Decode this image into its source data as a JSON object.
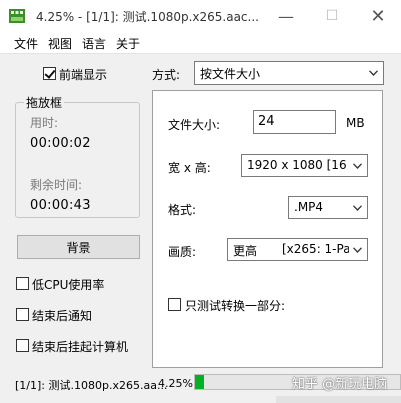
{
  "window": {
    "title": "4.25% - [1/1]: 测试.1080p.x265.aac...",
    "min_symbol": "—",
    "max_symbol": "☐",
    "close_symbol": "✕"
  },
  "menu": [
    "文件",
    "视图",
    "语言",
    "关于"
  ],
  "left": {
    "preview_label": "前端显示",
    "preview_checked": true,
    "drag_box_title": "拖放框",
    "elapsed_label": "用时:",
    "elapsed_value": "00:00:02",
    "remaining_label": "剩余时间:",
    "remaining_value": "00:00:43",
    "background_button": "背景",
    "options": [
      "低CPU使用率",
      "结束后通知",
      "结束后挂起计算机"
    ]
  },
  "right": {
    "method_label": "方式:",
    "method_value": "按文件大小",
    "filesize_label": "文件大小:",
    "filesize_value": "24",
    "filesize_unit": "MB",
    "resolution_label": "宽 x 高:",
    "resolution_value": "1920 x 1080  [16",
    "format_label": "格式:",
    "format_value": ".MP4",
    "quality_label": "画质:",
    "quality_value": "更高",
    "quality_detail": "[x265: 1-Pa",
    "partial_label": "只测试转换一部分:"
  },
  "status": {
    "file": "[1/1]: 测试.1080p.x265.aa...",
    "percent": "4.25%",
    "progress": 0.0425
  },
  "watermark": "知乎 @新玩电脑",
  "colors": {
    "progress_fill": "#06b025"
  }
}
